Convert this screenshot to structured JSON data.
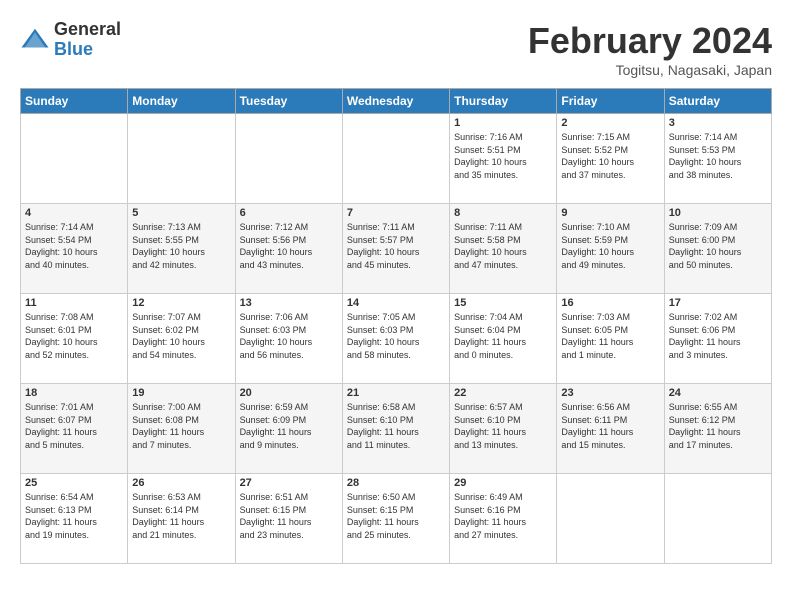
{
  "header": {
    "logo_general": "General",
    "logo_blue": "Blue",
    "month_title": "February 2024",
    "location": "Togitsu, Nagasaki, Japan"
  },
  "days_of_week": [
    "Sunday",
    "Monday",
    "Tuesday",
    "Wednesday",
    "Thursday",
    "Friday",
    "Saturday"
  ],
  "weeks": [
    [
      {
        "day": "",
        "info": ""
      },
      {
        "day": "",
        "info": ""
      },
      {
        "day": "",
        "info": ""
      },
      {
        "day": "",
        "info": ""
      },
      {
        "day": "1",
        "info": "Sunrise: 7:16 AM\nSunset: 5:51 PM\nDaylight: 10 hours\nand 35 minutes."
      },
      {
        "day": "2",
        "info": "Sunrise: 7:15 AM\nSunset: 5:52 PM\nDaylight: 10 hours\nand 37 minutes."
      },
      {
        "day": "3",
        "info": "Sunrise: 7:14 AM\nSunset: 5:53 PM\nDaylight: 10 hours\nand 38 minutes."
      }
    ],
    [
      {
        "day": "4",
        "info": "Sunrise: 7:14 AM\nSunset: 5:54 PM\nDaylight: 10 hours\nand 40 minutes."
      },
      {
        "day": "5",
        "info": "Sunrise: 7:13 AM\nSunset: 5:55 PM\nDaylight: 10 hours\nand 42 minutes."
      },
      {
        "day": "6",
        "info": "Sunrise: 7:12 AM\nSunset: 5:56 PM\nDaylight: 10 hours\nand 43 minutes."
      },
      {
        "day": "7",
        "info": "Sunrise: 7:11 AM\nSunset: 5:57 PM\nDaylight: 10 hours\nand 45 minutes."
      },
      {
        "day": "8",
        "info": "Sunrise: 7:11 AM\nSunset: 5:58 PM\nDaylight: 10 hours\nand 47 minutes."
      },
      {
        "day": "9",
        "info": "Sunrise: 7:10 AM\nSunset: 5:59 PM\nDaylight: 10 hours\nand 49 minutes."
      },
      {
        "day": "10",
        "info": "Sunrise: 7:09 AM\nSunset: 6:00 PM\nDaylight: 10 hours\nand 50 minutes."
      }
    ],
    [
      {
        "day": "11",
        "info": "Sunrise: 7:08 AM\nSunset: 6:01 PM\nDaylight: 10 hours\nand 52 minutes."
      },
      {
        "day": "12",
        "info": "Sunrise: 7:07 AM\nSunset: 6:02 PM\nDaylight: 10 hours\nand 54 minutes."
      },
      {
        "day": "13",
        "info": "Sunrise: 7:06 AM\nSunset: 6:03 PM\nDaylight: 10 hours\nand 56 minutes."
      },
      {
        "day": "14",
        "info": "Sunrise: 7:05 AM\nSunset: 6:03 PM\nDaylight: 10 hours\nand 58 minutes."
      },
      {
        "day": "15",
        "info": "Sunrise: 7:04 AM\nSunset: 6:04 PM\nDaylight: 11 hours\nand 0 minutes."
      },
      {
        "day": "16",
        "info": "Sunrise: 7:03 AM\nSunset: 6:05 PM\nDaylight: 11 hours\nand 1 minute."
      },
      {
        "day": "17",
        "info": "Sunrise: 7:02 AM\nSunset: 6:06 PM\nDaylight: 11 hours\nand 3 minutes."
      }
    ],
    [
      {
        "day": "18",
        "info": "Sunrise: 7:01 AM\nSunset: 6:07 PM\nDaylight: 11 hours\nand 5 minutes."
      },
      {
        "day": "19",
        "info": "Sunrise: 7:00 AM\nSunset: 6:08 PM\nDaylight: 11 hours\nand 7 minutes."
      },
      {
        "day": "20",
        "info": "Sunrise: 6:59 AM\nSunset: 6:09 PM\nDaylight: 11 hours\nand 9 minutes."
      },
      {
        "day": "21",
        "info": "Sunrise: 6:58 AM\nSunset: 6:10 PM\nDaylight: 11 hours\nand 11 minutes."
      },
      {
        "day": "22",
        "info": "Sunrise: 6:57 AM\nSunset: 6:10 PM\nDaylight: 11 hours\nand 13 minutes."
      },
      {
        "day": "23",
        "info": "Sunrise: 6:56 AM\nSunset: 6:11 PM\nDaylight: 11 hours\nand 15 minutes."
      },
      {
        "day": "24",
        "info": "Sunrise: 6:55 AM\nSunset: 6:12 PM\nDaylight: 11 hours\nand 17 minutes."
      }
    ],
    [
      {
        "day": "25",
        "info": "Sunrise: 6:54 AM\nSunset: 6:13 PM\nDaylight: 11 hours\nand 19 minutes."
      },
      {
        "day": "26",
        "info": "Sunrise: 6:53 AM\nSunset: 6:14 PM\nDaylight: 11 hours\nand 21 minutes."
      },
      {
        "day": "27",
        "info": "Sunrise: 6:51 AM\nSunset: 6:15 PM\nDaylight: 11 hours\nand 23 minutes."
      },
      {
        "day": "28",
        "info": "Sunrise: 6:50 AM\nSunset: 6:15 PM\nDaylight: 11 hours\nand 25 minutes."
      },
      {
        "day": "29",
        "info": "Sunrise: 6:49 AM\nSunset: 6:16 PM\nDaylight: 11 hours\nand 27 minutes."
      },
      {
        "day": "",
        "info": ""
      },
      {
        "day": "",
        "info": ""
      }
    ]
  ]
}
